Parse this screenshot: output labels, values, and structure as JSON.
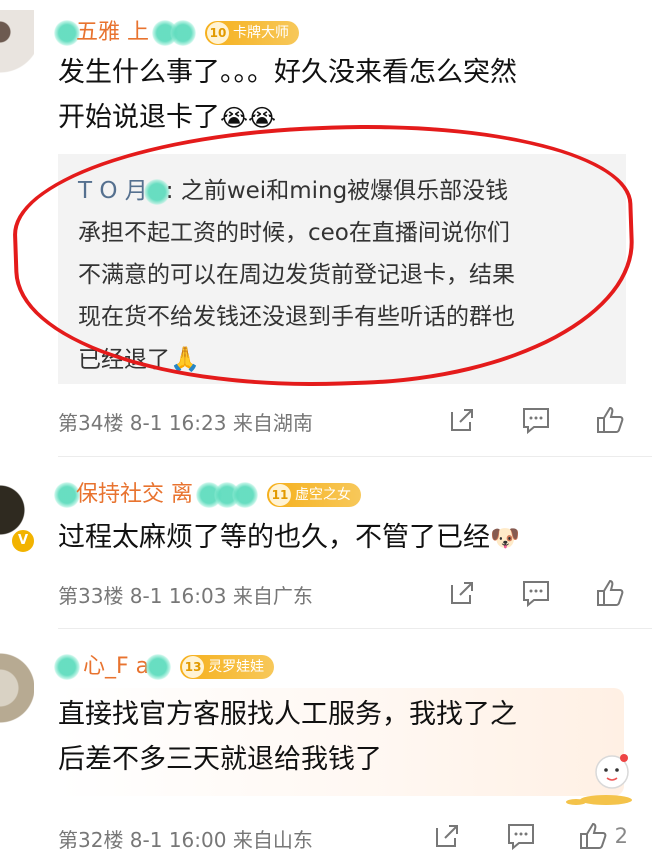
{
  "comments": [
    {
      "username": "五雅 上 ",
      "badge_level": "10",
      "badge": "卡牌大师",
      "text_line1": "发生什么事了。。。好久没来看怎么突然",
      "text_line2": "开始说退卡了",
      "emojis": "😭😭",
      "reply": {
        "user": "T O 月",
        "line1": ": 之前wei和ming被爆俱乐部没钱",
        "line2": "承担不起工资的时候，ceo在直播间说你们",
        "line3": "不满意的可以在周边发货前登记退卡，结果",
        "line4": "现在货不给发钱还没退到手有些听话的群也",
        "line5": "已经退了",
        "emoji": "🙏"
      },
      "meta": "第34楼  8-1 16:23  来自湖南"
    },
    {
      "username": "保持社交  离    ",
      "badge_level": "11",
      "badge": "虚空之女",
      "text": "过程太麻烦了等的也久，不管了已经",
      "emoji": "🐶",
      "verified": "V",
      "meta": "第33楼  8-1 16:03  来自广东"
    },
    {
      "username": "  心_F  a",
      "badge_level": "13",
      "badge": "灵罗娃娃",
      "text_line1": "直接找官方客服找人工服务，我找了之",
      "text_line2": "后差不多三天就退给我钱了",
      "meta": "第32楼  8-1 16:00  来自山东",
      "likes": "2"
    }
  ],
  "colors": {
    "username": "#e8732f",
    "meta": "#777777",
    "reply_user": "#55708f",
    "annotation_circle": "#e41b1b",
    "badge": "#f6b01c"
  },
  "icons": [
    "share-icon",
    "comment-icon",
    "like-icon"
  ]
}
